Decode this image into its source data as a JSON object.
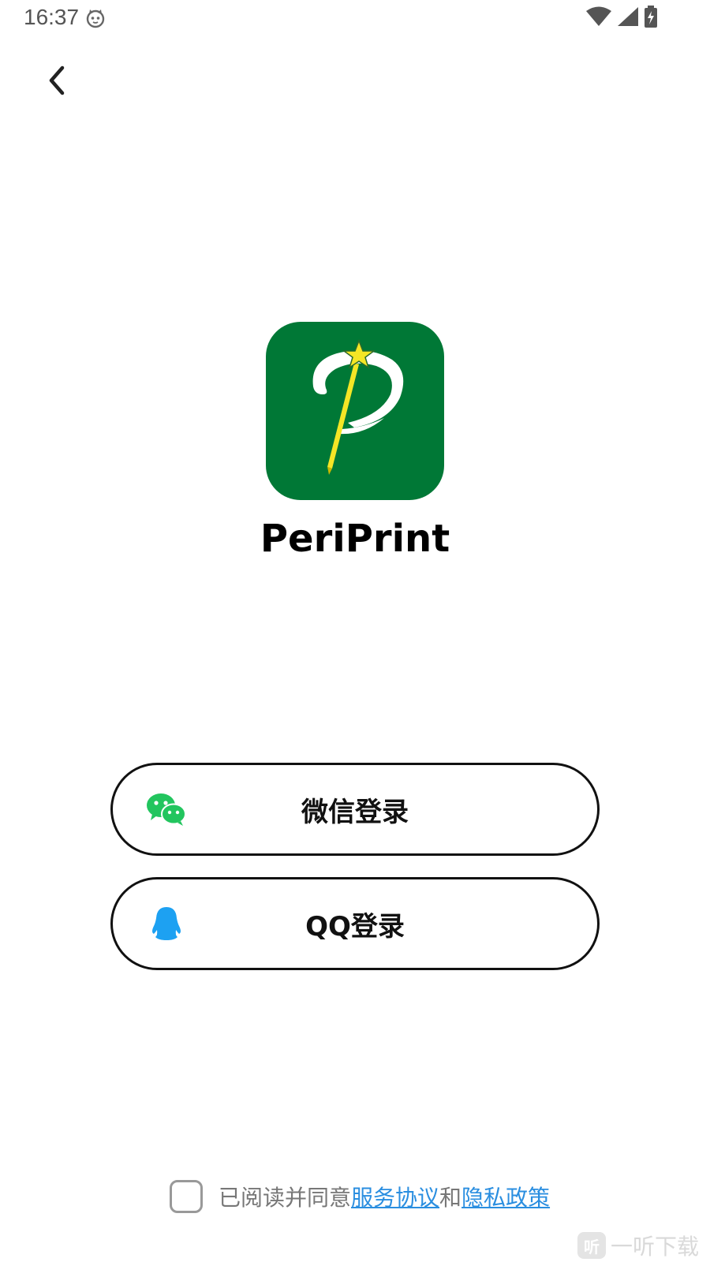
{
  "status_bar": {
    "time": "16:37",
    "icons": [
      "cat-notification-icon",
      "wifi-icon",
      "cellular-signal-icon",
      "battery-charging-icon"
    ]
  },
  "nav": {
    "back_icon": "chevron-left-icon"
  },
  "app": {
    "name": "PeriPrint",
    "logo_bg_color": "#007836",
    "logo_accent_color": "#f4e626"
  },
  "login": {
    "wechat_label": "微信登录",
    "wechat_icon": "wechat-icon",
    "wechat_color": "#22c55e",
    "qq_label": "QQ登录",
    "qq_icon": "qq-penguin-icon",
    "qq_color": "#1da1f2"
  },
  "agreement": {
    "prefix": "已阅读并同意",
    "terms_link": "服务协议",
    "connector": "和",
    "privacy_link": "隐私政策",
    "checked": false,
    "link_color": "#2a8ee0"
  },
  "watermark": {
    "badge": "听",
    "text": "一听下载"
  }
}
